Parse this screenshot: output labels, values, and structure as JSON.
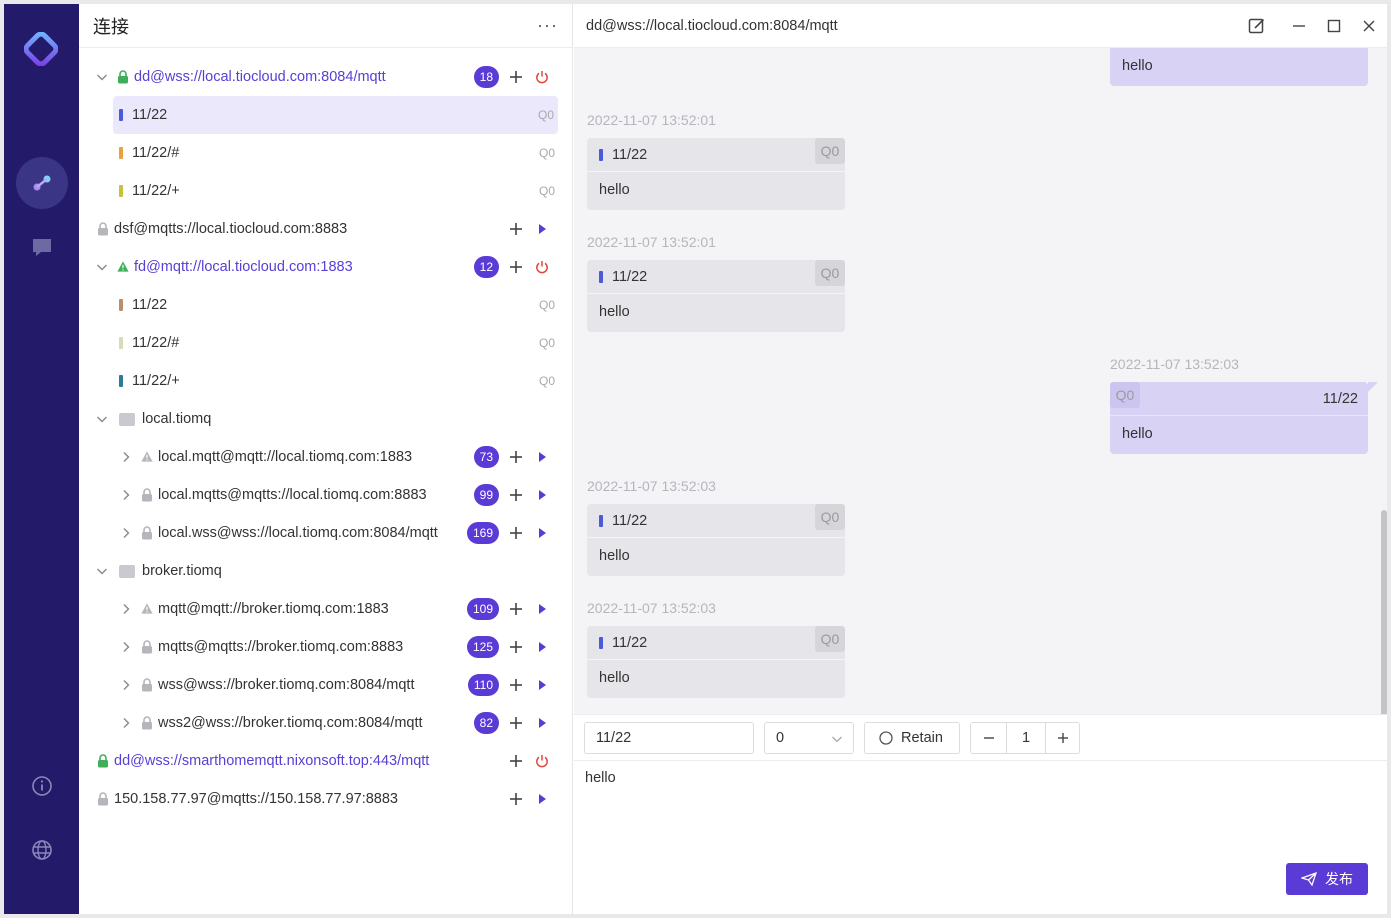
{
  "sidebar": {
    "nav": [
      {
        "icon": "connections-icon"
      },
      {
        "icon": "chat-icon"
      },
      {
        "icon": "info-icon"
      },
      {
        "icon": "globe-icon"
      }
    ]
  },
  "connections": {
    "title": "连接",
    "more": "···",
    "items": [
      {
        "label": "dd@wss://local.tiocloud.com:8084/mqtt",
        "badge": "18"
      },
      {
        "label": "dsf@mqtts://local.tiocloud.com:8883"
      },
      {
        "label": "fd@mqtt://local.tiocloud.com:1883",
        "badge": "12"
      },
      {
        "label": "dd@wss://smarthomemqtt.nixonsoft.top:443/mqtt"
      },
      {
        "label": "150.158.77.97@mqtts://150.158.77.97:8883"
      }
    ],
    "topics_a": [
      {
        "label": "11/22",
        "qos": "Q0",
        "color": "#4b5ad8"
      },
      {
        "label": "11/22/#",
        "qos": "Q0",
        "color": "#e8a23c"
      },
      {
        "label": "11/22/+",
        "qos": "Q0",
        "color": "#c7c23a"
      }
    ],
    "topics_b": [
      {
        "label": "11/22",
        "qos": "Q0",
        "color": "#b88f6e"
      },
      {
        "label": "11/22/#",
        "qos": "Q0",
        "color": "#d5dcb6"
      },
      {
        "label": "11/22/+",
        "qos": "Q0",
        "color": "#2b7b98"
      }
    ],
    "groups": [
      {
        "label": "local.tiomq",
        "children": [
          {
            "label": "local.mqtt@mqtt://local.tiomq.com:1883",
            "badge": "73"
          },
          {
            "label": "local.mqtts@mqtts://local.tiomq.com:8883",
            "badge": "99"
          },
          {
            "label": "local.wss@wss://local.tiomq.com:8084/mqtt",
            "badge": "169"
          }
        ]
      },
      {
        "label": "broker.tiomq",
        "children": [
          {
            "label": "mqtt@mqtt://broker.tiomq.com:1883",
            "badge": "109"
          },
          {
            "label": "mqtts@mqtts://broker.tiomq.com:8883",
            "badge": "125"
          },
          {
            "label": "wss@wss://broker.tiomq.com:8084/mqtt",
            "badge": "110"
          },
          {
            "label": "wss2@wss://broker.tiomq.com:8084/mqtt",
            "badge": "82"
          }
        ]
      }
    ]
  },
  "main": {
    "title": "dd@wss://local.tiocloud.com:8084/mqtt",
    "top_payload": "hello",
    "messages": [
      {
        "time": "2022-11-07 13:52:01",
        "topic": "11/22",
        "qos": "Q0",
        "payload": "hello",
        "dir": "in"
      },
      {
        "time": "2022-11-07 13:52:01",
        "topic": "11/22",
        "qos": "Q0",
        "payload": "hello",
        "dir": "in"
      },
      {
        "time": "2022-11-07 13:52:03",
        "topic": "11/22",
        "qos": "Q0",
        "payload": "hello",
        "dir": "out"
      },
      {
        "time": "2022-11-07 13:52:03",
        "topic": "11/22",
        "qos": "Q0",
        "payload": "hello",
        "dir": "in"
      },
      {
        "time": "2022-11-07 13:52:03",
        "topic": "11/22",
        "qos": "Q0",
        "payload": "hello",
        "dir": "in"
      }
    ],
    "publish": {
      "topic": "11/22",
      "qos": "0",
      "retain_label": "Retain",
      "count": "1",
      "payload": "hello",
      "send_label": "发布"
    }
  },
  "colors": {
    "accent": "#5b3bd6",
    "rail": "#231b6a",
    "danger": "#e0483b"
  }
}
